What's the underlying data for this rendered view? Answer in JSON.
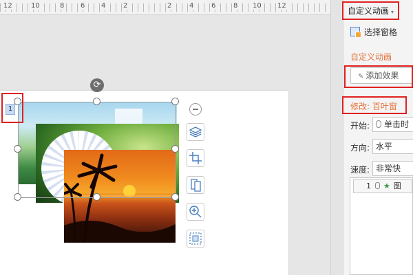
{
  "ruler": {
    "numbers": [
      "12",
      "10",
      "8",
      "6",
      "4",
      "2",
      "2",
      "4",
      "6",
      "8",
      "10",
      "12"
    ]
  },
  "slide": {
    "animation_order": "1"
  },
  "toolbar": {
    "items": [
      "minus-icon",
      "layers-icon",
      "crop-icon",
      "replace-picture-icon",
      "zoom-icon",
      "fit-frame-icon"
    ]
  },
  "pane": {
    "title": "自定义动画",
    "selection_pane": "选择窗格",
    "section_title": "自定义动画",
    "add_effect": "添加效果",
    "modify": "修改: 百叶窗",
    "start_label": "开始:",
    "start_value": "单击时",
    "direction_label": "方向:",
    "direction_value": "水平",
    "speed_label": "速度:",
    "speed_value": "非常快",
    "list": [
      {
        "order": "1",
        "label": "图"
      }
    ]
  },
  "colors": {
    "accent": "#e4723a",
    "highlight_box": "#e02020"
  }
}
